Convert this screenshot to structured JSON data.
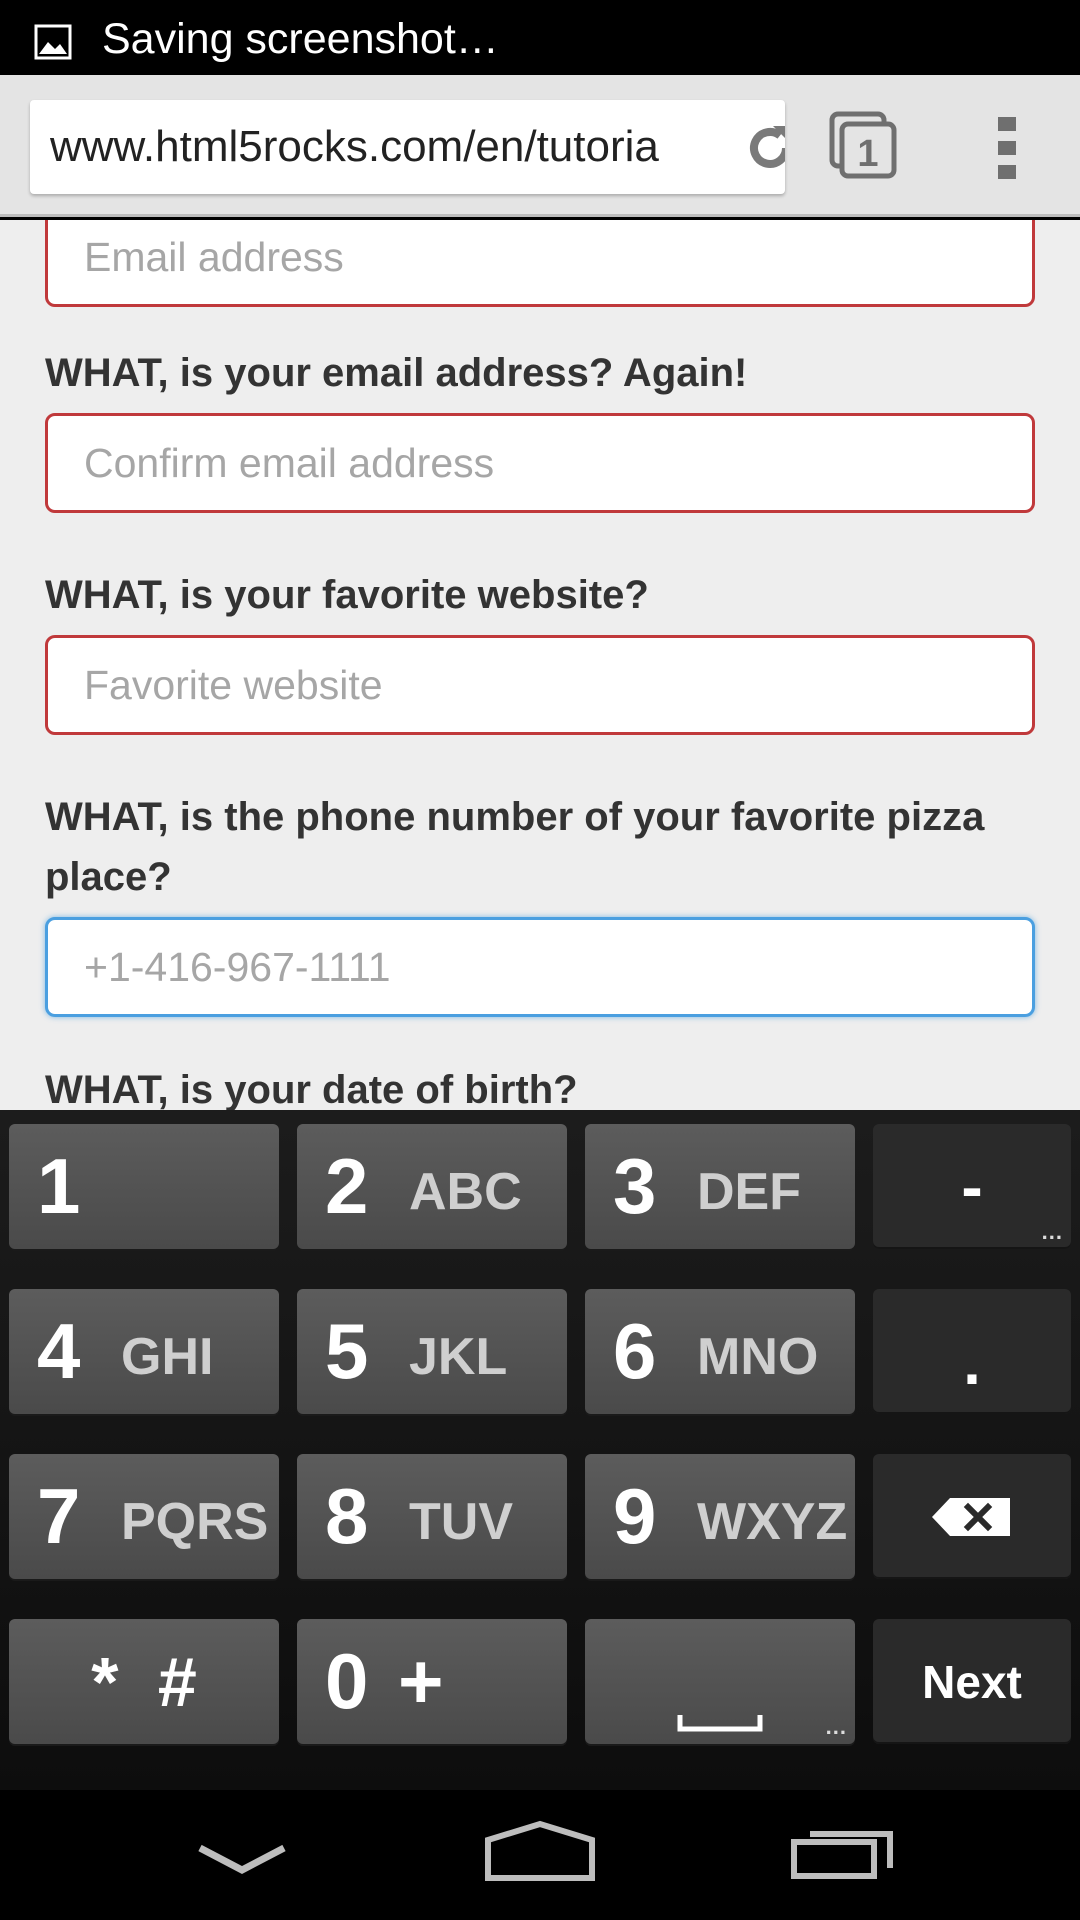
{
  "status_bar": {
    "notification_text": "Saving screenshot…",
    "icon": "image-icon"
  },
  "browser": {
    "url": "www.html5rocks.com/en/tutoria",
    "tab_count": "1",
    "icons": [
      "reload-icon",
      "tabs-icon",
      "overflow-menu-icon"
    ]
  },
  "form": {
    "email_placeholder": "Email address",
    "confirm_label": "WHAT, is your email address? Again!",
    "confirm_placeholder": "Confirm email address",
    "website_label": "WHAT, is your favorite website?",
    "website_placeholder": "Favorite website",
    "phone_label": "WHAT, is the phone number of your favorite pizza place?",
    "phone_placeholder": "+1-416-967-1111",
    "dob_label": "WHAT, is your date of birth?"
  },
  "keyboard": {
    "keys": [
      {
        "digit": "1",
        "letters": ""
      },
      {
        "digit": "2",
        "letters": "ABC"
      },
      {
        "digit": "3",
        "letters": "DEF"
      },
      {
        "digit": "4",
        "letters": "GHI"
      },
      {
        "digit": "5",
        "letters": "JKL"
      },
      {
        "digit": "6",
        "letters": "MNO"
      },
      {
        "digit": "7",
        "letters": "PQRS"
      },
      {
        "digit": "8",
        "letters": "TUV"
      },
      {
        "digit": "9",
        "letters": "WXYZ"
      }
    ],
    "symbols_label": "* #",
    "zero_label": "0 +",
    "dash_label": "-",
    "period_label": ".",
    "next_label": "Next",
    "more_dots": "...",
    "icons": [
      "backspace-icon",
      "space-icon"
    ]
  },
  "navbar": {
    "icons": [
      "back-icon",
      "home-icon",
      "recent-apps-icon"
    ]
  }
}
